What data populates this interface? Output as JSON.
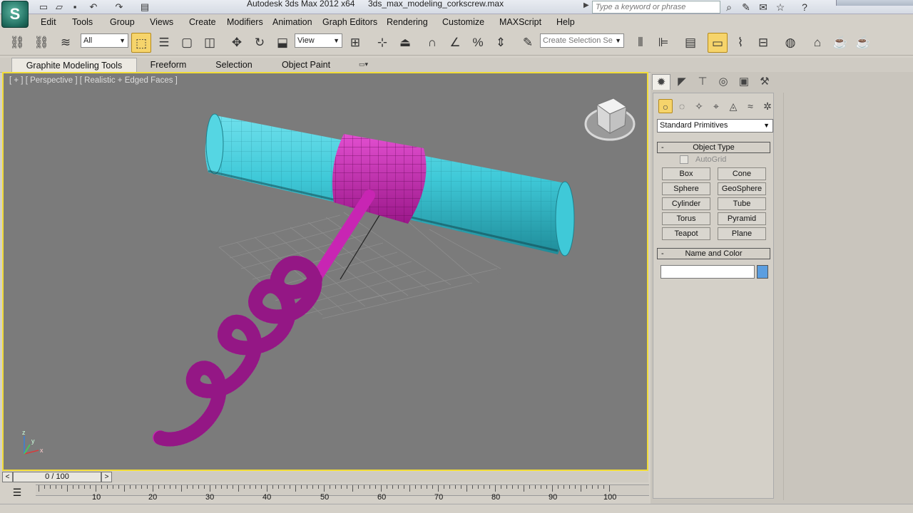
{
  "window": {
    "app_title": "Autodesk 3ds Max  2012 x64",
    "file_name": "3ds_max_modeling_corkscrew.max",
    "search_placeholder": "Type a keyword or phrase"
  },
  "menus": [
    "Edit",
    "Tools",
    "Group",
    "Views",
    "Create",
    "Modifiers",
    "Animation",
    "Graph Editors",
    "Rendering",
    "Customize",
    "MAXScript",
    "Help"
  ],
  "toolbar": {
    "selection_filter": "All",
    "reference_coord": "View",
    "named_selection_placeholder": "Create Selection Se"
  },
  "ribbon": {
    "tabs": [
      "Graphite Modeling Tools",
      "Freeform",
      "Selection",
      "Object Paint"
    ]
  },
  "viewport": {
    "label": "[ + ] [ Perspective ] [ Realistic + Edged Faces ]",
    "axis_labels": {
      "x": "x",
      "y": "y",
      "z": "z"
    }
  },
  "command_panel": {
    "category_dropdown": "Standard Primitives",
    "object_type": {
      "title": "Object Type",
      "autogrid_label": "AutoGrid",
      "buttons": [
        "Box",
        "Cone",
        "Sphere",
        "GeoSphere",
        "Cylinder",
        "Tube",
        "Torus",
        "Pyramid",
        "Teapot",
        "Plane"
      ]
    },
    "name_and_color": {
      "title": "Name and Color",
      "name_value": "",
      "color": "#5b9ee0"
    }
  },
  "time": {
    "slider_label": "0 / 100",
    "ticks": [
      "10",
      "20",
      "30",
      "40",
      "50",
      "60",
      "70",
      "80",
      "90",
      "100"
    ]
  },
  "colors": {
    "accent_viewport_border": "#f1dc38",
    "handle_color": "#3fc9d8",
    "screw_color": "#c825b3",
    "viewport_bg": "#7b7b7b"
  }
}
